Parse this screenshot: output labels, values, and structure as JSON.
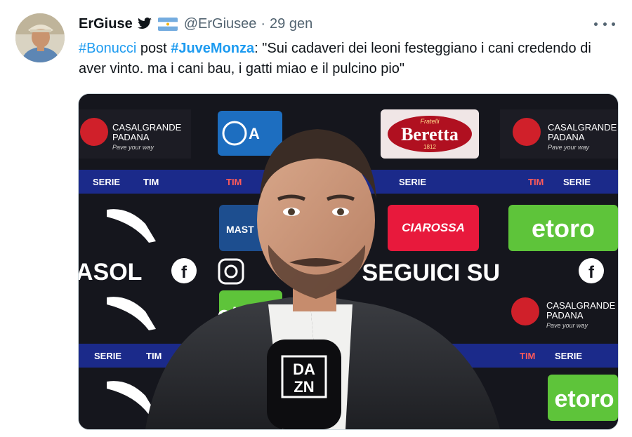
{
  "tweet": {
    "display_name": "ErGiuse",
    "handle": "@ErGiusee",
    "separator": "·",
    "time": "29 gen",
    "badges": [
      "twitter-bird-icon",
      "argentina-flag-icon"
    ],
    "text": {
      "hashtag1": "#Bonucci",
      "word_post": " post ",
      "hashtag2": "#JuveMonza",
      "quote": ": \"Sui cadaveri dei leoni festeggiano i cani credendo di aver vinto. ma i cani bau, i gatti miao e il pulcino pio\""
    }
  },
  "media": {
    "sponsor_casalgrande": "CASALGRANDE",
    "sponsor_padana": "PADANA",
    "sponsor_tagline": "Pave your way",
    "sponsor_beretta": "Beretta",
    "sponsor_beretta_small": "Fratelli",
    "sponsor_beretta_year": "1812",
    "sponsor_etoro": "etoro",
    "sponsor_cirossa": "CIAROSSA",
    "sponsor_mast": "MAST",
    "band_serie": "SERIE",
    "band_tim": "TIM",
    "seguici": "SEGUICI SU",
    "asol": "ASOL",
    "dazn_top": "DA",
    "dazn_bottom": "ZN"
  },
  "colors": {
    "link": "#1d9bf0",
    "secondary_text": "#536471",
    "etoro_green": "#5ec43a",
    "band_blue": "#1b2a8a",
    "casalgrande_red": "#d0202a",
    "beretta_red": "#b01020"
  }
}
